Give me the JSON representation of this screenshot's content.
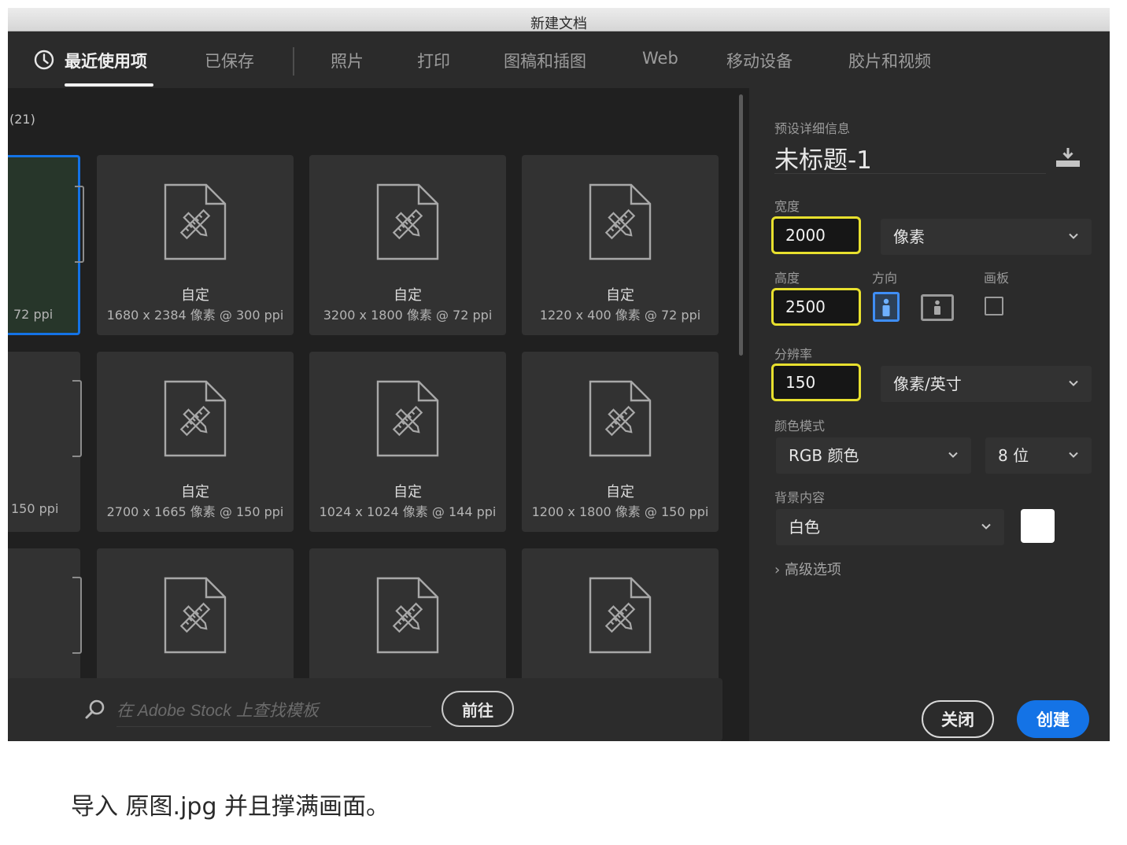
{
  "window": {
    "title": "新建文档"
  },
  "tabs": [
    {
      "label": "最近使用项",
      "active": true
    },
    {
      "label": "已保存"
    },
    {
      "label": "照片"
    },
    {
      "label": "打印"
    },
    {
      "label": "图稿和插图"
    },
    {
      "label": "Web"
    },
    {
      "label": "移动设备"
    },
    {
      "label": "胶片和视频"
    }
  ],
  "recent": {
    "count_label": "(21)",
    "cards": [
      {
        "meta": "72 ppi",
        "selected": true,
        "partial": true
      },
      {
        "title": "自定",
        "meta": "1680 x 2384 像素 @ 300 ppi"
      },
      {
        "title": "自定",
        "meta": "3200 x 1800 像素 @ 72 ppi"
      },
      {
        "title": "自定",
        "meta": "1220 x 400 像素 @ 72 ppi"
      },
      {
        "meta": "150 ppi",
        "partial": true
      },
      {
        "title": "自定",
        "meta": "2700 x 1665 像素 @ 150 ppi"
      },
      {
        "title": "自定",
        "meta": "1024 x 1024 像素 @ 144 ppi"
      },
      {
        "title": "自定",
        "meta": "1200 x 1800 像素 @ 150 ppi"
      },
      {
        "partial": true
      },
      {},
      {},
      {}
    ]
  },
  "stock": {
    "placeholder": "在 Adobe Stock 上查找模板",
    "go_label": "前往"
  },
  "preset": {
    "section_label": "预设详细信息",
    "doc_name": "未标题-1",
    "width_label": "宽度",
    "width_value": "2000",
    "width_unit": "像素",
    "height_label": "高度",
    "height_value": "2500",
    "orientation_label": "方向",
    "artboard_label": "画板",
    "resolution_label": "分辨率",
    "resolution_value": "150",
    "resolution_unit": "像素/英寸",
    "color_mode_label": "颜色模式",
    "color_mode": "RGB 颜色",
    "bit_depth": "8 位",
    "background_label": "背景内容",
    "background": "白色",
    "background_color": "#ffffff",
    "advanced_label": "高级选项"
  },
  "buttons": {
    "close": "关闭",
    "create": "创建"
  },
  "colors": {
    "accent": "#1473e6",
    "highlight": "#e8e02e"
  },
  "caption": "导入 原图.jpg 并且撑满画面。"
}
